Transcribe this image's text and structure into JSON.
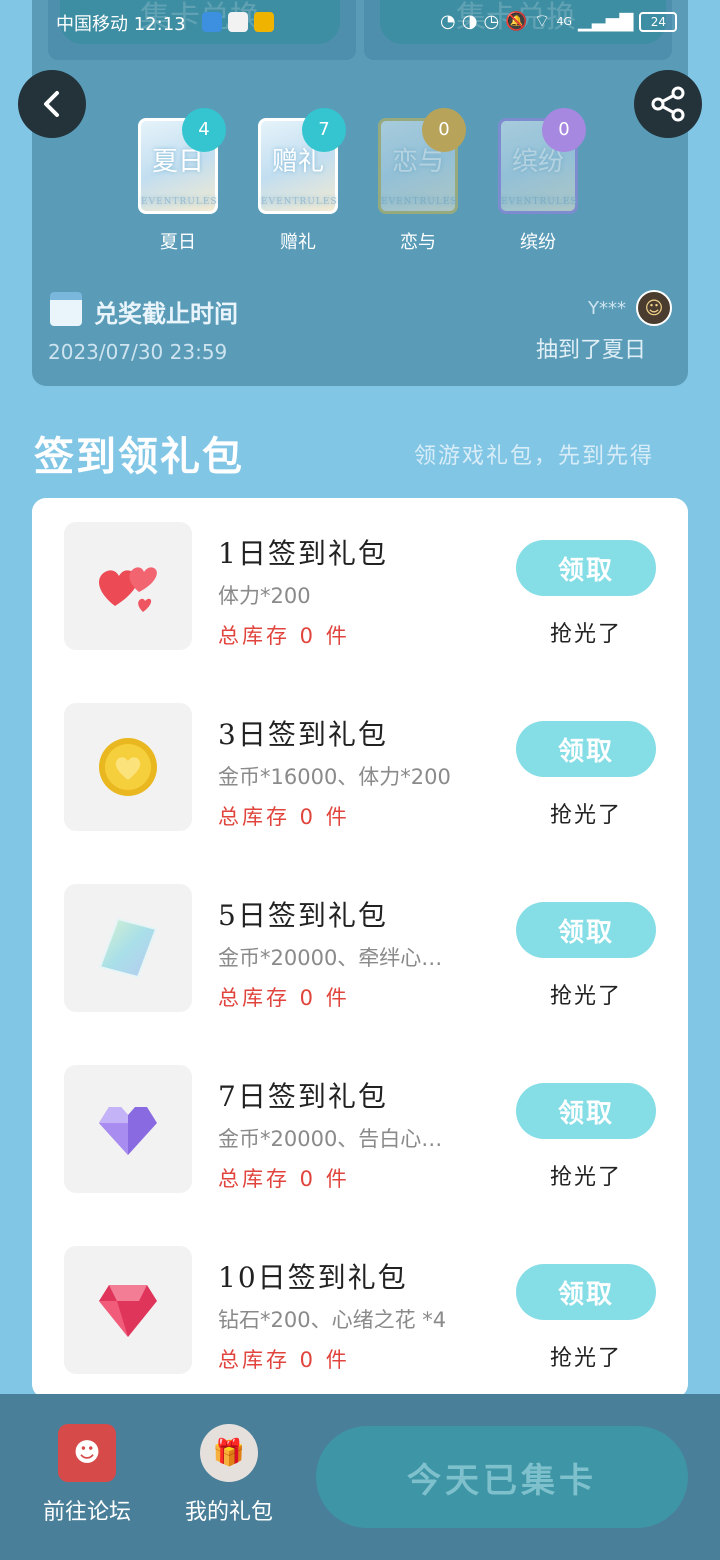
{
  "status_bar": {
    "carrier_time": "中国移动 12:13",
    "network": "4G",
    "battery": "24"
  },
  "watermark": "集卡兑换",
  "cards": [
    {
      "title": "夏日",
      "label": "夏日",
      "count": "4",
      "badge_color": "#35c5d0"
    },
    {
      "title": "赠礼",
      "label": "赠礼",
      "count": "7",
      "badge_color": "#35c5d0"
    },
    {
      "title": "恋与",
      "label": "恋与",
      "count": "0",
      "badge_color": "#b8a35a"
    },
    {
      "title": "缤纷",
      "label": "缤纷",
      "count": "0",
      "badge_color": "#a688e0"
    }
  ],
  "card_subtext": "EVENTRULES",
  "deadline": {
    "title": "兑奖截止时间",
    "date": "2023/07/30 23:59"
  },
  "winner": {
    "name": "Y***",
    "message": "抽到了夏日"
  },
  "section": {
    "title": "签到领礼包",
    "subtitle": "领游戏礼包，先到先得"
  },
  "gifts": [
    {
      "name": "1日签到礼包",
      "desc": "体力*200",
      "stock": "总库存 0 件",
      "claim": "领取",
      "status": "抢光了",
      "icon": "hearts-icon"
    },
    {
      "name": "3日签到礼包",
      "desc": "金币*16000、体力*200",
      "stock": "总库存 0 件",
      "claim": "领取",
      "status": "抢光了",
      "icon": "gold-coin-icon"
    },
    {
      "name": "5日签到礼包",
      "desc": "金币*20000、牵绊心…",
      "stock": "总库存 0 件",
      "claim": "领取",
      "status": "抢光了",
      "icon": "card-icon"
    },
    {
      "name": "7日签到礼包",
      "desc": "金币*20000、告白心…",
      "stock": "总库存 0 件",
      "claim": "领取",
      "status": "抢光了",
      "icon": "purple-heart-gem-icon"
    },
    {
      "name": "10日签到礼包",
      "desc": "钻石*200、心绪之花 *4",
      "stock": "总库存 0 件",
      "claim": "领取",
      "status": "抢光了",
      "icon": "red-diamond-icon"
    }
  ],
  "bottom": {
    "forum_label": "前往论坛",
    "my_gifts_label": "我的礼包",
    "collect_button": "今天已集卡"
  },
  "colors": {
    "background": "#82c6e6",
    "claim_button": "#85dde6",
    "stock_red": "#e0443c",
    "bottom_bar": "#4a7f99"
  }
}
